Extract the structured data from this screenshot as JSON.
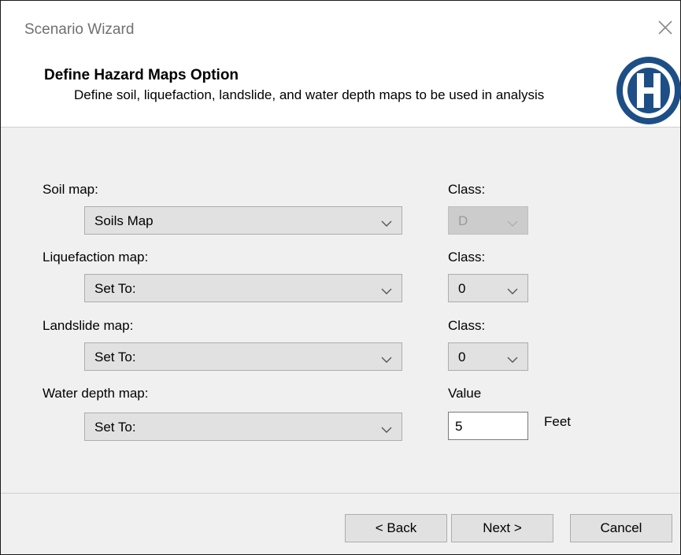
{
  "window": {
    "title": "Scenario Wizard"
  },
  "header": {
    "heading": "Define Hazard Maps Option",
    "subheading": "Define soil, liquefaction, landslide, and water depth maps to be used in analysis"
  },
  "form": {
    "soil": {
      "label": "Soil map:",
      "value": "Soils Map",
      "class_label": "Class:",
      "class_value": "D",
      "class_disabled": true
    },
    "liquefaction": {
      "label": "Liquefaction map:",
      "value": "Set To:",
      "class_label": "Class:",
      "class_value": "0"
    },
    "landslide": {
      "label": "Landslide map:",
      "value": "Set To:",
      "class_label": "Class:",
      "class_value": "0"
    },
    "water": {
      "label": "Water depth map:",
      "value": "Set To:",
      "value_label": "Value",
      "depth_value": "5",
      "unit": "Feet"
    }
  },
  "buttons": {
    "back": "< Back",
    "next": "Next >",
    "cancel": "Cancel"
  },
  "colors": {
    "logo_blue": "#1d4f86",
    "dialog_bg": "#f0f0f0",
    "control_bg": "#e1e1e1"
  },
  "icons": {
    "close": "close-icon",
    "chevron": "chevron-down-icon",
    "logo": "hazus-logo"
  }
}
